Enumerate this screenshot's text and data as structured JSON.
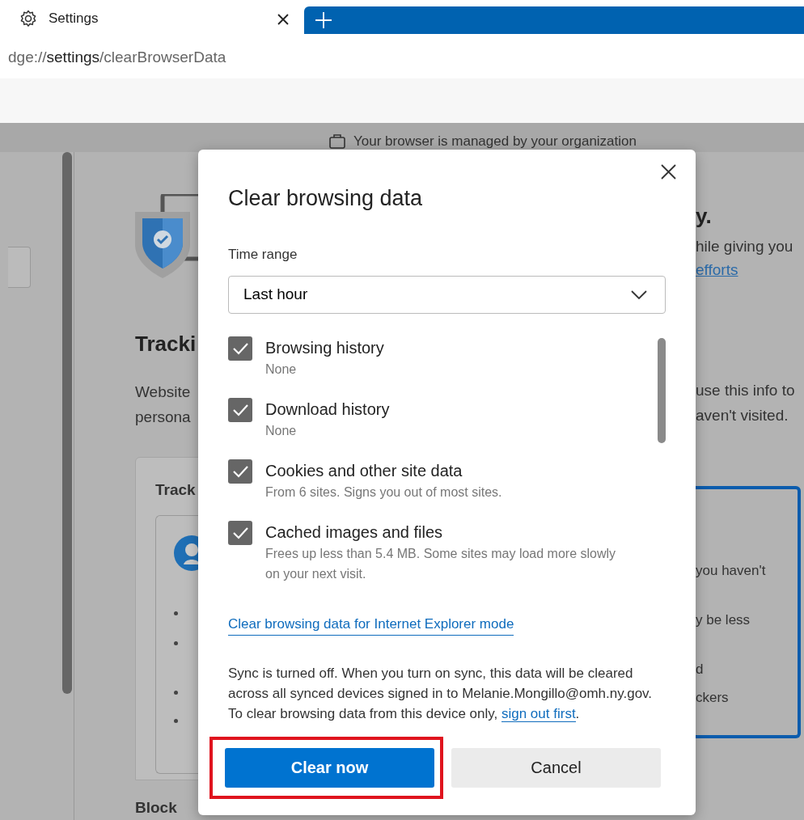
{
  "browser": {
    "tab": {
      "title": "Settings"
    },
    "address": {
      "scheme": "dge://",
      "host": "settings",
      "path": "/clearBrowserData"
    }
  },
  "background_page": {
    "managed_notice": "Your browser is managed by your organization",
    "left": {
      "heading": "Tracki",
      "lines": [
        "Website",
        "persona"
      ],
      "card_title": "Track",
      "next_heading": "Block"
    },
    "right": {
      "heading": "y.",
      "line": "hile giving you",
      "link": "efforts",
      "lines": [
        "use this info to",
        "aven't visited."
      ],
      "box_lines": [
        "you haven't",
        "y be less",
        "d",
        "ckers"
      ]
    }
  },
  "dialog": {
    "title": "Clear browsing data",
    "time_range_label": "Time range",
    "time_range": "Last hour",
    "items": [
      {
        "label": "Browsing history",
        "detail": "None",
        "checked": true
      },
      {
        "label": "Download history",
        "detail": "None",
        "checked": true
      },
      {
        "label": "Cookies and other site data",
        "detail": "From 6 sites. Signs you out of most sites.",
        "checked": true
      },
      {
        "label": "Cached images and files",
        "detail": "Frees up less than 5.4 MB. Some sites may load more slowly on your next visit.",
        "checked": true
      }
    ],
    "ie_link": "Clear browsing data for Internet Explorer mode",
    "sync_note": {
      "text": "Sync is turned off. When you turn on sync, this data will be cleared across all synced devices signed in to Melanie.Mongillo@omh.ny.gov. To clear browsing data from this device only, ",
      "link": "sign out first",
      "end": "."
    },
    "buttons": [
      {
        "label": "Clear now",
        "kind": "primary",
        "highlighted": true
      },
      {
        "label": "Cancel",
        "kind": "secondary",
        "highlighted": false
      }
    ]
  }
}
